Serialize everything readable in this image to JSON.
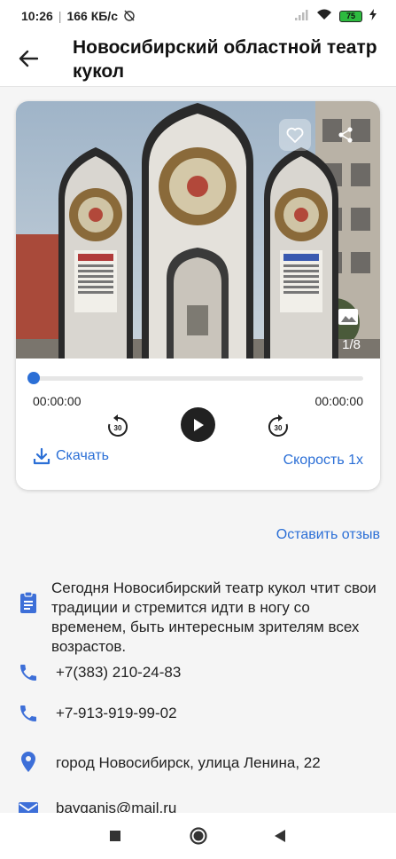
{
  "status_bar": {
    "time": "10:26",
    "network_speed": "166 КБ/с",
    "battery_level": "75"
  },
  "header": {
    "title": "Новосибирский областной театр кукол"
  },
  "gallery": {
    "counter": "1/8"
  },
  "player": {
    "progress": 0,
    "current_time": "00:00:00",
    "total_time": "00:00:00",
    "rewind_seconds": "30",
    "forward_seconds": "30",
    "download_label": "Скачать",
    "speed_label": "Скорость 1x"
  },
  "review_link": "Оставить отзыв",
  "info": {
    "description": "Сегодня Новосибирский театр кукол чтит свои традиции и стремится идти в ногу со временем, быть интересным зрителям всех возрастов.",
    "phone_1": "+7(383) 210-24-83",
    "phone_2": "+7-913-919-99-02",
    "address": "город Новосибирск, улица Ленина, 22",
    "email": "bayganis@mail.ru"
  },
  "colors": {
    "accent": "#2b6fd6",
    "icon": "#3d6fd8"
  }
}
